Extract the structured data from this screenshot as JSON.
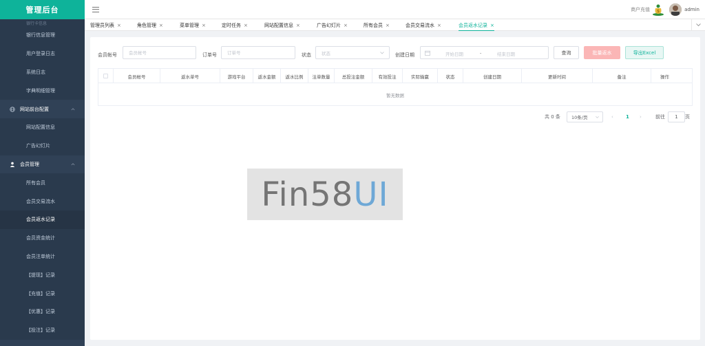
{
  "app": {
    "title": "管理后台",
    "recharge_label": "商户充值",
    "username": "admin"
  },
  "sidebar": {
    "partial_top": "银行卡信息",
    "items": [
      {
        "label": "银行信息管理",
        "kind": "sub"
      },
      {
        "label": "用户登录日志",
        "kind": "sub"
      },
      {
        "label": "系统日志",
        "kind": "sub"
      },
      {
        "label": "字典明细管理",
        "kind": "sub"
      },
      {
        "label": "网站前台配置",
        "kind": "group",
        "icon": "globe-icon"
      },
      {
        "label": "网站配置信息",
        "kind": "sub"
      },
      {
        "label": "广告幻灯片",
        "kind": "sub"
      },
      {
        "label": "会员管理",
        "kind": "group",
        "icon": "user-icon"
      },
      {
        "label": "所有会员",
        "kind": "sub"
      },
      {
        "label": "会员交易流水",
        "kind": "sub"
      },
      {
        "label": "会员返水记录",
        "kind": "sub",
        "active": true
      },
      {
        "label": "会员资金统计",
        "kind": "sub"
      },
      {
        "label": "会员注单统计",
        "kind": "sub"
      },
      {
        "label": "【提现】记录",
        "kind": "sub"
      },
      {
        "label": "【充值】记录",
        "kind": "sub"
      },
      {
        "label": "【优惠】记录",
        "kind": "sub"
      },
      {
        "label": "【投注】记录",
        "kind": "sub"
      }
    ]
  },
  "tabs": [
    {
      "label": "管理员列表"
    },
    {
      "label": "角色管理"
    },
    {
      "label": "菜单管理"
    },
    {
      "label": "定时任务"
    },
    {
      "label": "网站配置信息"
    },
    {
      "label": "广告幻灯片"
    },
    {
      "label": "所有会员"
    },
    {
      "label": "会员交易流水"
    },
    {
      "label": "会员返水记录",
      "active": true
    }
  ],
  "filters": {
    "account_label": "会员帐号",
    "account_placeholder": "会员帐号",
    "order_label": "订单号",
    "order_placeholder": "订单号",
    "status_label": "状态",
    "status_placeholder": "状态",
    "date_label": "创建日期",
    "start_placeholder": "开始日期",
    "separator": "-",
    "end_placeholder": "结束日期",
    "query_button": "查询",
    "batch_button": "批量返水",
    "export_button": "导出Excel"
  },
  "table": {
    "columns": [
      "会员帐号",
      "返水单号",
      "游戏平台",
      "返水金额",
      "返水比例",
      "注单数量",
      "总投注金额",
      "有效投注",
      "实际输赢",
      "状态",
      "创建日期",
      "更新时间",
      "备注",
      "操作"
    ],
    "empty_text": "暂无数据"
  },
  "pagination": {
    "total_text": "共 0 条",
    "page_size": "10条/页",
    "prev": "‹",
    "current_page": "1",
    "next": "›",
    "goto_label": "前往",
    "goto_value": "1",
    "page_unit": "页"
  },
  "watermark": {
    "part1": "Fin58",
    "part2": "UI"
  },
  "colors": {
    "sidebar_bg": "#304156",
    "brand": "#0eb39a",
    "danger_light": "#fbb6b6"
  }
}
